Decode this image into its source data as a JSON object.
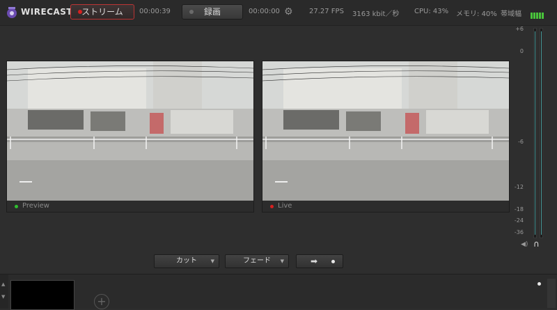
{
  "brand": "WIRECAST",
  "toolbar": {
    "stream_label": "ストリーム",
    "stream_time": "00:00:39",
    "record_label": "録画",
    "record_time": "00:00:00",
    "fps": "27.27 FPS",
    "bitrate": "3163 kbit／秒",
    "cpu": "CPU: 43%",
    "memory": "メモリ: 40%",
    "bandwidth": "帯域幅"
  },
  "preview": {
    "label": "Preview"
  },
  "live": {
    "label": "Live"
  },
  "meter_scale": [
    "+6",
    "0",
    "-6",
    "-12",
    "-18",
    "-24",
    "-36"
  ],
  "transitions": {
    "cut": "カット",
    "fade": "フェード"
  },
  "colors": {
    "stream_accent": "#d62020",
    "preview_dot": "#2fbf2f",
    "live_dot": "#d62020",
    "bandwidth_bars": "#49c43b"
  }
}
